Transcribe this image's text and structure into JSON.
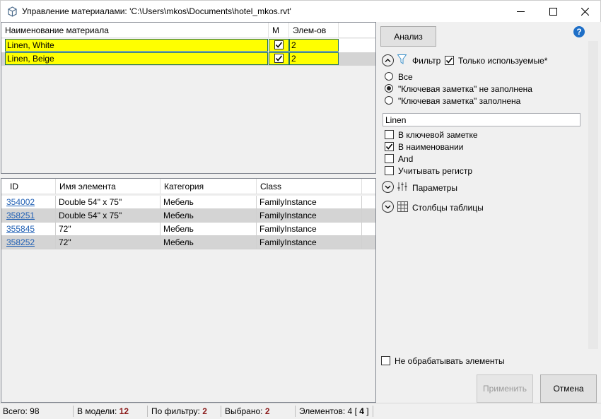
{
  "window": {
    "title": "Управление материалами: 'C:\\Users\\mkos\\Documents\\hotel_mkos.rvt'"
  },
  "materials_table": {
    "columns": [
      "Наименование материала",
      "M",
      "Элем-ов"
    ],
    "rows": [
      {
        "name": "Linen, White",
        "checked": true,
        "count": "2"
      },
      {
        "name": "Linen, Beige",
        "checked": true,
        "count": "2"
      }
    ]
  },
  "elements_table": {
    "columns": [
      "ID",
      "Имя элемента",
      "Категория",
      "Class"
    ],
    "rows": [
      {
        "id": "354002",
        "name": "Double 54\" x 75\"",
        "category": "Мебель",
        "class": "FamilyInstance"
      },
      {
        "id": "358251",
        "name": "Double 54\" x 75\"",
        "category": "Мебель",
        "class": "FamilyInstance"
      },
      {
        "id": "355845",
        "name": "72\"",
        "category": "Мебель",
        "class": "FamilyInstance"
      },
      {
        "id": "358252",
        "name": "72\"",
        "category": "Мебель",
        "class": "FamilyInstance"
      }
    ]
  },
  "right_panel": {
    "analyze_button": "Анализ",
    "help_icon": "?",
    "filter": {
      "label": "Фильтр",
      "only_used_label": "Только используемые*",
      "only_used_checked": true,
      "radio_options": [
        "Все",
        "\"Ключевая заметка\" не заполнена",
        "\"Ключевая заметка\" заполнена"
      ],
      "radio_selected_index": 1,
      "search_value": "Linen",
      "checkboxes": [
        {
          "label": "В ключевой заметке",
          "checked": false
        },
        {
          "label": "В наименовании",
          "checked": true
        },
        {
          "label": "And",
          "checked": false
        },
        {
          "label": "Учитывать регистр",
          "checked": false
        }
      ]
    },
    "parameters_label": "Параметры",
    "columns_label": "Столбцы таблицы",
    "dont_process_label": "Не обрабатывать элементы",
    "dont_process_checked": false,
    "apply_button": "Применить",
    "cancel_button": "Отмена"
  },
  "status_bar": {
    "total_label": "Всего:",
    "total_value": "98",
    "in_model_label": "В модели:",
    "in_model_value": "12",
    "by_filter_label": "По фильтру:",
    "by_filter_value": "2",
    "selected_label": "Выбрано:",
    "selected_value": "2",
    "elements_label": "Элементов:",
    "elements_value": "4",
    "elements_bracket_value": "4"
  },
  "colors": {
    "highlight": "#ffff00",
    "link": "#1f5fb4",
    "status_value": "#8b1a1a",
    "help_blue": "#1e6fc7"
  }
}
